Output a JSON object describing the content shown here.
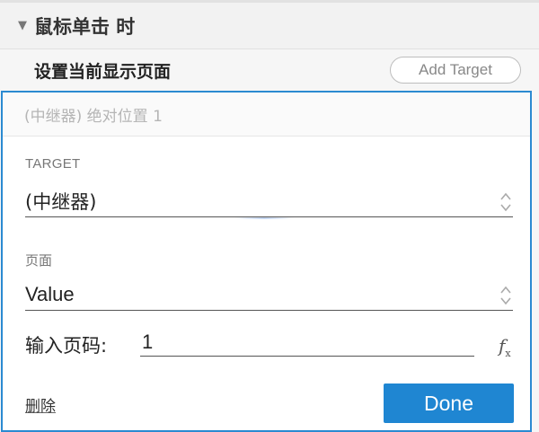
{
  "event": {
    "title": "鼠标单击 时",
    "collapse_icon": "triangle-down-icon"
  },
  "action": {
    "title": "设置当前显示页面",
    "add_target_label": "Add Target"
  },
  "panel": {
    "summary": "(中继器) 绝对位置 1",
    "target": {
      "label": "TARGET",
      "value": "(中继器)"
    },
    "page": {
      "label": "页面",
      "value": "Value"
    },
    "page_number": {
      "label": "输入页码:",
      "value": "1"
    },
    "fx_icon": "function-icon",
    "delete_label": "删除",
    "done_label": "Done"
  },
  "colors": {
    "accent": "#2b8ad1",
    "done_button": "#1f86d2",
    "placeholder_text": "#b5b5b5"
  }
}
